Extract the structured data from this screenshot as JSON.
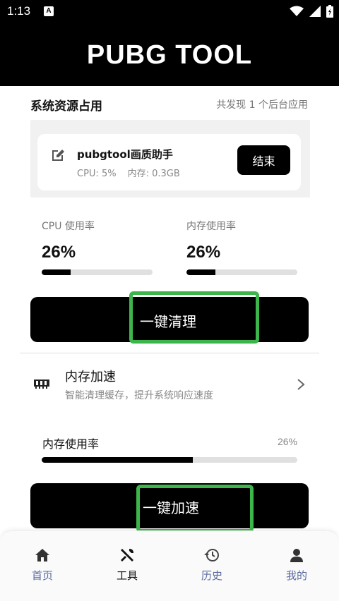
{
  "status_bar": {
    "time": "1:13",
    "badge": "A"
  },
  "header": {
    "title": "PUBG TOOL"
  },
  "resources": {
    "title": "系统资源占用",
    "summary": "共发现 1 个后台应用",
    "process": {
      "name": "pubgtool画质助手",
      "cpu": "CPU: 5%",
      "memory": "内存: 0.3GB",
      "end_label": "结束",
      "icon": "edit-icon"
    },
    "cpu": {
      "label": "CPU 使用率",
      "value": "26%",
      "fraction": 0.26
    },
    "memory": {
      "label": "内存使用率",
      "value": "26%",
      "fraction": 0.26
    },
    "clean_label": "一键清理"
  },
  "memory_boost": {
    "title": "内存加速",
    "description": "智能清理缓存，提升系统响应速度",
    "icon": "memory-icon",
    "rate_label": "内存使用率",
    "rate_value": "26%",
    "rate_fraction": 0.59,
    "boost_label": "一键加速"
  },
  "nav": {
    "items": [
      {
        "label": "首页",
        "icon": "home-icon"
      },
      {
        "label": "工具",
        "icon": "tools-icon",
        "active": true
      },
      {
        "label": "历史",
        "icon": "history-icon"
      },
      {
        "label": "我的",
        "icon": "person-icon"
      }
    ]
  },
  "colors": {
    "accent": "#000000",
    "highlight": "#3cb54a",
    "nav_inactive": "#5a6aa0"
  }
}
